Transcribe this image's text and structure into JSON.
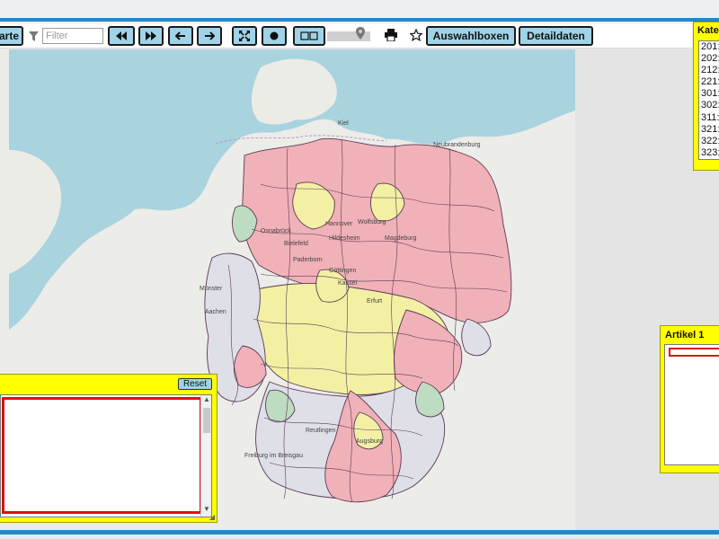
{
  "toolbar": {
    "karte_label": "arte",
    "filter_placeholder": "Filter",
    "auswahlboxen_label": "Auswahlboxen",
    "detaildaten_label": "Detaildaten"
  },
  "kategorie_panel": {
    "title": "Kateg",
    "items": [
      "201:",
      "202:",
      "212:",
      "221:",
      "301:",
      "302:",
      "311:",
      "321:",
      "322:",
      "323:"
    ]
  },
  "artikel_panel": {
    "title": "Artikel 1"
  },
  "left_panel": {
    "reset_label": "Reset"
  },
  "map": {
    "place_labels": [
      "Hannover",
      "Wolfsburg",
      "Hildesheim",
      "Magdeburg",
      "Osnabrück",
      "Bielefeld",
      "Paderborn",
      "Göttingen",
      "Münster",
      "Aachen",
      "Freiburg im Breisgau",
      "Augsburg",
      "Reutlingen",
      "Kiel",
      "Neubrandenburg",
      "Kassel",
      "Erfurt"
    ],
    "colors": {
      "sea": "#a9d3df",
      "land_foreign": "#eeeeea",
      "region_red": "#f0b1b8",
      "region_yellow": "#f3f0a4",
      "region_green": "#bedcc2",
      "region_gray": "#dfdfe8",
      "border": "#5a3a55"
    }
  },
  "colors": {
    "button_bg": "#9fd3e8",
    "panel_yellow": "#ffff00",
    "accent_blue": "#1c8ad0",
    "selection_red": "#dd1111"
  }
}
